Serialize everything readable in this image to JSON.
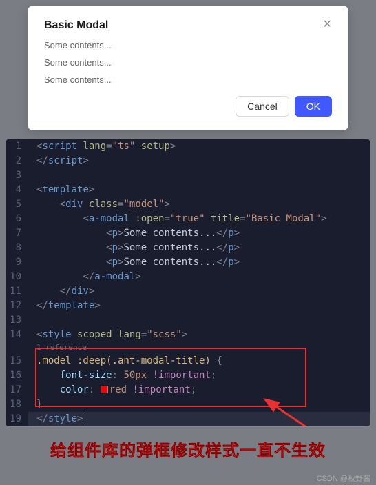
{
  "modal": {
    "title": "Basic Modal",
    "content1": "Some contents...",
    "content2": "Some contents...",
    "content3": "Some contents...",
    "cancel": "Cancel",
    "ok": "OK"
  },
  "code": {
    "reference": "1 reference",
    "lines": {
      "l1": "1",
      "l2": "2",
      "l3": "3",
      "l4": "4",
      "l5": "5",
      "l6": "6",
      "l7": "7",
      "l8": "8",
      "l9": "9",
      "l10": "10",
      "l11": "11",
      "l12": "12",
      "l13": "13",
      "l14": "14",
      "l15": "15",
      "l16": "16",
      "l17": "17",
      "l18": "18",
      "l19": "19"
    },
    "tokens": {
      "script": "script",
      "lang": "lang",
      "ts": "\"ts\"",
      "setup": "setup",
      "template": "template",
      "div": "div",
      "class": "class",
      "model_val": "\"model\"",
      "model_txt": "model",
      "amodal": "a-modal",
      "open": ":open",
      "true": "\"true\"",
      "title": "title",
      "basic_modal": "\"Basic Modal\"",
      "p": "p",
      "some_contents": "Some contents...",
      "style": "style",
      "scoped": "scoped",
      "scss": "\"scss\"",
      "selector": ".model :deep(.ant-modal-title)",
      "font_size": "font-size",
      "fs_val": "50px",
      "important": "!important",
      "color_prop": "color",
      "red": "red"
    }
  },
  "caption": "给组件库的弹框修改样式一直不生效",
  "watermark": "CSDN @秋野酱"
}
